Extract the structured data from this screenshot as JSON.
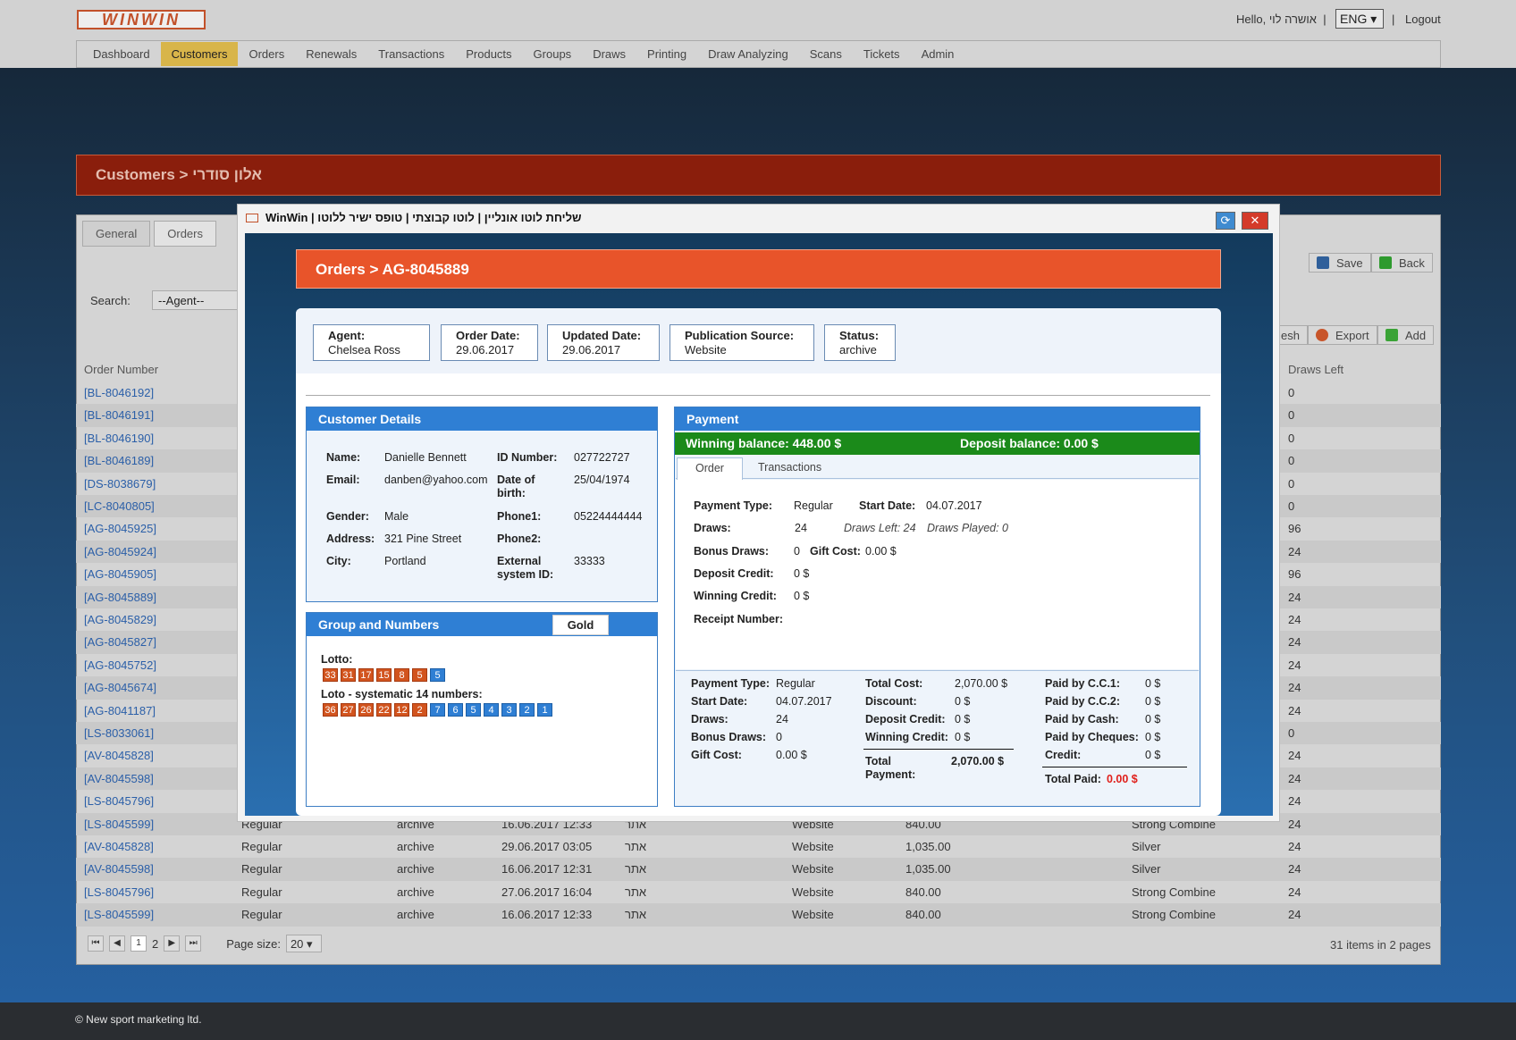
{
  "app": {
    "logo": "WINWIN",
    "hello": "Hello, אושרה לוי",
    "lang": "ENG",
    "logout": "Logout",
    "sep": "|"
  },
  "nav": [
    "Dashboard",
    "Customers",
    "Orders",
    "Renewals",
    "Transactions",
    "Products",
    "Groups",
    "Draws",
    "Printing",
    "Draw Analyzing",
    "Scans",
    "Tickets",
    "Admin"
  ],
  "nav_active": 1,
  "breadcrumb": "Customers > אלון סודרי",
  "page_tabs": [
    "General",
    "Orders"
  ],
  "search": {
    "label": "Search:",
    "value": "--Agent--"
  },
  "toolbar": {
    "save": "Save",
    "back": "Back",
    "refresh": "esh",
    "export": "Export",
    "add": "Add"
  },
  "table": {
    "col_order": "Order Number",
    "col_draws": "Draws Left",
    "orders": [
      "[BL-8046192]",
      "[BL-8046191]",
      "[BL-8046190]",
      "[BL-8046189]",
      "[DS-8038679]",
      "[LC-8040805]",
      "[AG-8045925]",
      "[AG-8045924]",
      "[AG-8045905]",
      "[AG-8045889]",
      "[AG-8045829]",
      "[AG-8045827]",
      "[AG-8045752]",
      "[AG-8045674]",
      "[AG-8041187]",
      "[LS-8033061]",
      "[AV-8045828]",
      "[AV-8045598]",
      "[LS-8045796]",
      "[LS-8045599]",
      "[AV-8045828]",
      "[AV-8045598]",
      "[LS-8045796]",
      "[LS-8045599]"
    ],
    "draws": [
      "0",
      "0",
      "0",
      "0",
      "0",
      "0",
      "96",
      "24",
      "96",
      "24",
      "24",
      "24",
      "24",
      "24",
      "24",
      "0",
      "24",
      "24",
      "24",
      "24",
      "24",
      "24",
      "24",
      "24"
    ],
    "visible_rows": [
      {
        "type": "Regular",
        "status": "archive",
        "date": "16.06.2017 12:33",
        "src": "אתר",
        "pub": "Website",
        "amount": "840.00",
        "product": "Strong Combine"
      },
      {
        "type": "Regular",
        "status": "archive",
        "date": "29.06.2017 03:05",
        "src": "אתר",
        "pub": "Website",
        "amount": "1,035.00",
        "product": "Silver"
      },
      {
        "type": "Regular",
        "status": "archive",
        "date": "16.06.2017 12:31",
        "src": "אתר",
        "pub": "Website",
        "amount": "1,035.00",
        "product": "Silver"
      },
      {
        "type": "Regular",
        "status": "archive",
        "date": "27.06.2017 16:04",
        "src": "אתר",
        "pub": "Website",
        "amount": "840.00",
        "product": "Strong Combine"
      },
      {
        "type": "Regular",
        "status": "archive",
        "date": "16.06.2017 12:33",
        "src": "אתר",
        "pub": "Website",
        "amount": "840.00",
        "product": "Strong Combine"
      }
    ]
  },
  "pager": {
    "p1": "1",
    "p2": "2",
    "size_label": "Page size:",
    "size": "20",
    "items": "31 items in 2 pages"
  },
  "footer": "© New sport marketing ltd.",
  "modal": {
    "title": "WinWin | שליחת לוטו אונליין | לוטו קבוצתי | טופס ישיר ללוטו",
    "header": "Orders > AG-8045889",
    "chips": [
      {
        "k": "Agent:",
        "v": "Chelsea Ross"
      },
      {
        "k": "Order Date:",
        "v": "29.06.2017"
      },
      {
        "k": "Updated Date:",
        "v": "29.06.2017"
      },
      {
        "k": "Publication Source:",
        "v": "Website"
      },
      {
        "k": "Status:",
        "v": "archive"
      }
    ],
    "customer": {
      "title": "Customer Details",
      "name_k": "Name:",
      "name": "Danielle Bennett",
      "id_k": "ID Number:",
      "id": "027722727",
      "email_k": "Email:",
      "email": "danben@yahoo.com",
      "dob_k": "Date of birth:",
      "dob": "25/04/1974",
      "gender_k": "Gender:",
      "gender": "Male",
      "phone1_k": "Phone1:",
      "phone1": "05224444444",
      "address_k": "Address:",
      "address": "321 Pine Street",
      "phone2_k": "Phone2:",
      "city_k": "City:",
      "city": "Portland",
      "ext_k": "External system ID:",
      "ext": "33333"
    },
    "group": {
      "title": "Group and Numbers",
      "badge": "Gold",
      "lotto_label": "Lotto:",
      "lotto_red": [
        "33",
        "31",
        "17",
        "15",
        "8",
        "5"
      ],
      "lotto_blue": [
        "5"
      ],
      "sys_label": "Loto - systematic 14 numbers:",
      "sys_red": [
        "36",
        "27",
        "26",
        "22",
        "12",
        "2"
      ],
      "sys_blue": [
        "7",
        "6",
        "5",
        "4",
        "3",
        "2",
        "1"
      ]
    },
    "payment": {
      "title": "Payment",
      "winning": "Winning balance: 448.00 $",
      "deposit": "Deposit balance: 0.00 $",
      "tabs": [
        "Order",
        "Transactions"
      ],
      "ptype_k": "Payment Type:",
      "ptype": "Regular",
      "start_k": "Start Date:",
      "start": "04.07.2017",
      "draws_k": "Draws:",
      "draws": "24",
      "draws_left": "Draws Left: 24",
      "draws_played": "Draws Played: 0",
      "bonus_k": "Bonus Draws:",
      "bonus": "0",
      "gift_k": "Gift Cost:",
      "gift": "0.00 $",
      "depcred_k": "Deposit Credit:",
      "depcred": "0 $",
      "wincred_k": "Winning Credit:",
      "wincred": "0 $",
      "receipt_k": "Receipt Number:",
      "s": {
        "ptype_k": "Payment Type:",
        "ptype": "Regular",
        "start_k": "Start Date:",
        "start": "04.07.2017",
        "draws_k": "Draws:",
        "draws": "24",
        "bonus_k": "Bonus Draws:",
        "bonus": "0",
        "gift_k": "Gift Cost:",
        "gift": "0.00 $",
        "tcost_k": "Total Cost:",
        "tcost": "2,070.00 $",
        "disc_k": "Discount:",
        "disc": "0 $",
        "dep_k": "Deposit Credit:",
        "dep": "0 $",
        "win_k": "Winning Credit:",
        "win": "0 $",
        "tpay_k": "Total Payment:",
        "tpay": "2,070.00 $",
        "cc1_k": "Paid by C.C.1:",
        "cc1": "0 $",
        "cc2_k": "Paid by C.C.2:",
        "cc2": "0 $",
        "cash_k": "Paid by Cash:",
        "cash": "0 $",
        "chq_k": "Paid by Cheques:",
        "chq": "0 $",
        "cred_k": "Credit:",
        "cred": "0 $",
        "tpaid_k": "Total Paid:",
        "tpaid": "0.00 $"
      }
    }
  },
  "colors": {
    "accent": "#e8542a",
    "header_blue": "#2f7fd4",
    "green": "#1b8a1a"
  }
}
